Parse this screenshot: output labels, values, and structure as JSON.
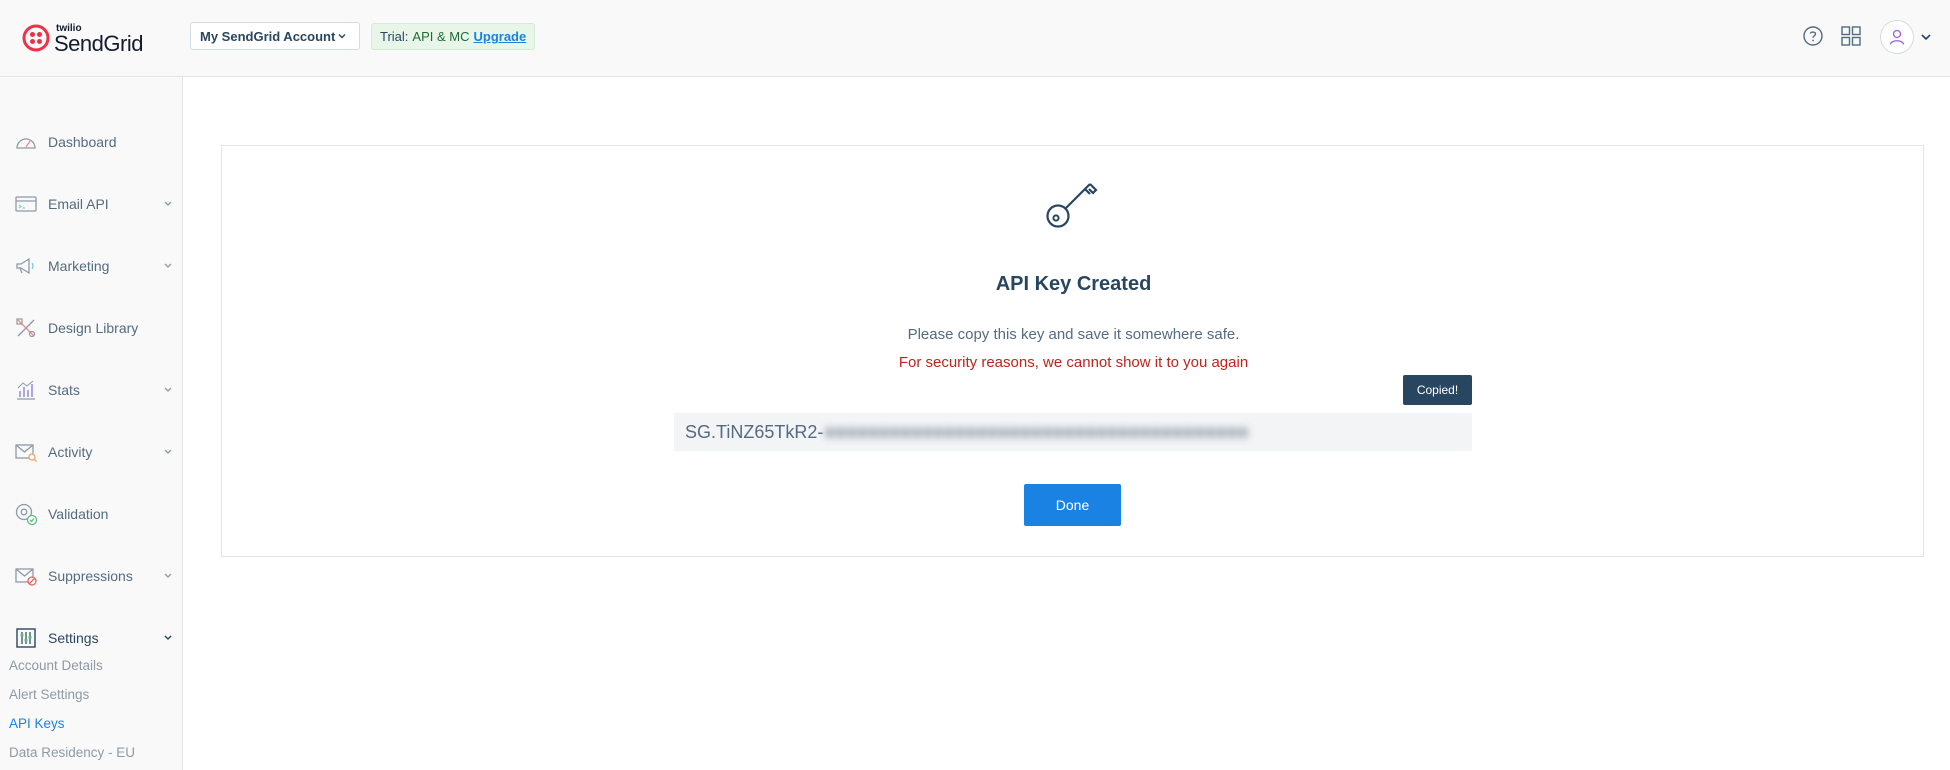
{
  "header": {
    "logo_small": "twilio",
    "logo_big": "SendGrid",
    "account_selector": "My SendGrid Account",
    "trial_prefix": "Trial:",
    "trial_plan": "API & MC",
    "upgrade_link": "Upgrade",
    "icons": [
      "help-icon",
      "apps-grid-icon",
      "user-avatar-icon",
      "chevron-down-icon"
    ]
  },
  "sidebar": {
    "items": [
      {
        "label": "Dashboard",
        "icon": "speedometer-icon"
      },
      {
        "label": "Email API",
        "icon": "email-api-icon"
      },
      {
        "label": "Marketing",
        "icon": "megaphone-icon"
      },
      {
        "label": "Design Library",
        "icon": "design-tools-icon"
      },
      {
        "label": "Stats",
        "icon": "bar-chart-icon"
      },
      {
        "label": "Activity",
        "icon": "envelope-search-icon"
      },
      {
        "label": "Validation",
        "icon": "at-check-icon"
      },
      {
        "label": "Suppressions",
        "icon": "envelope-block-icon"
      },
      {
        "label": "Settings",
        "icon": "sliders-icon"
      }
    ],
    "settings_sub": [
      "Account Details",
      "Alert Settings",
      "API Keys",
      "Data Residency - EU"
    ],
    "active_sub": "API Keys"
  },
  "main": {
    "title": "API Key Created",
    "message": "Please copy this key and save it somewhere safe.",
    "warning": "For security reasons, we cannot show it to you again",
    "tooltip": "Copied!",
    "key_visible": "SG.TiNZ65TkR2-",
    "done_label": "Done"
  },
  "colors": {
    "primary": "#1a82e2",
    "text": "#294661",
    "warning": "#c0241c",
    "brand_red": "#f22f46"
  }
}
